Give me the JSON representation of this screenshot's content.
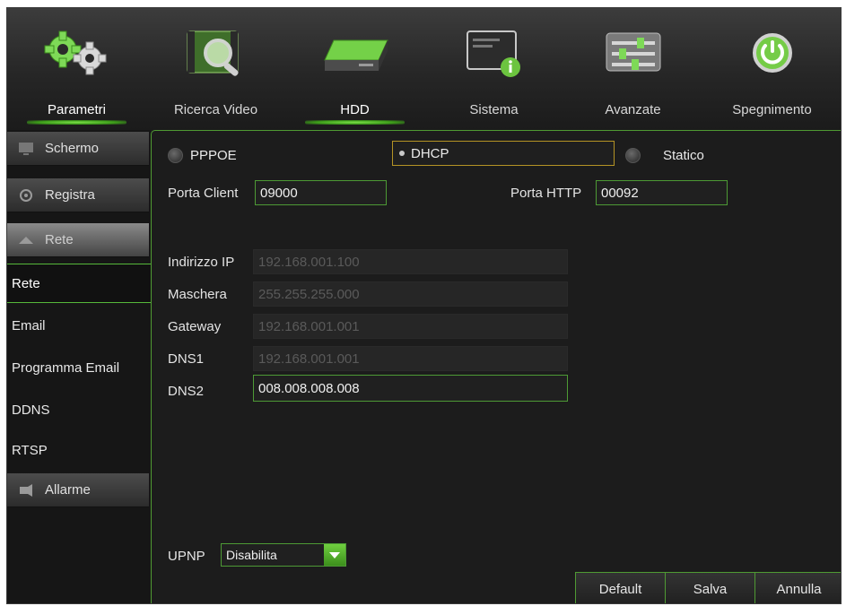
{
  "nav": {
    "items": [
      {
        "label": "Parametri",
        "icon": "gears-icon",
        "active": true
      },
      {
        "label": "Ricerca Video",
        "icon": "video-search-icon",
        "active": false
      },
      {
        "label": "HDD",
        "icon": "hdd-icon",
        "active": true
      },
      {
        "label": "Sistema",
        "icon": "system-info-icon",
        "active": false
      },
      {
        "label": "Avanzate",
        "icon": "sliders-icon",
        "active": false
      },
      {
        "label": "Spegnimento",
        "icon": "power-icon",
        "active": false
      }
    ]
  },
  "sidebar": {
    "headers": [
      {
        "label": "Schermo",
        "icon": "monitor-icon"
      },
      {
        "label": "Registra",
        "icon": "record-icon"
      },
      {
        "label": "Rete",
        "icon": "network-icon"
      },
      {
        "label": "Allarme",
        "icon": "alarm-icon"
      }
    ],
    "subitems": [
      {
        "label": "Rete",
        "active": true
      },
      {
        "label": "Email",
        "active": false
      },
      {
        "label": "Programma Email",
        "active": false
      },
      {
        "label": "DDNS",
        "active": false
      },
      {
        "label": "RTSP",
        "active": false
      }
    ]
  },
  "network": {
    "modes": {
      "pppoe": "PPPOE",
      "dhcp": "DHCP",
      "static": "Statico",
      "selected": "DHCP"
    },
    "client_port_label": "Porta Client",
    "client_port": "09000",
    "http_port_label": "Porta HTTP",
    "http_port": "00092",
    "ip_label": "Indirizzo IP",
    "ip": "192.168.001.100",
    "mask_label": "Maschera",
    "mask": "255.255.255.000",
    "gateway_label": "Gateway",
    "gateway": "192.168.001.001",
    "dns1_label": "DNS1",
    "dns1": "192.168.001.001",
    "dns2_label": "DNS2",
    "dns2": "008.008.008.008",
    "upnp_label": "UPNP",
    "upnp_value": "Disabilita"
  },
  "buttons": {
    "default": "Default",
    "save": "Salva",
    "cancel": "Annulla"
  },
  "colors": {
    "accent": "#4f9a33",
    "highlight": "#b49325",
    "background": "#1c1c1c"
  }
}
